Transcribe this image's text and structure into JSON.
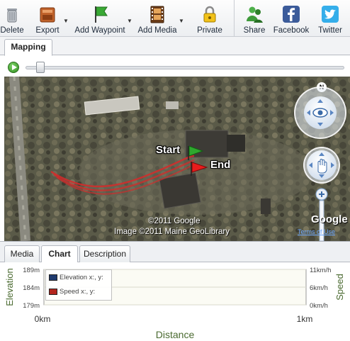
{
  "toolbar": {
    "buttons": [
      {
        "label": "Delete",
        "icon": "trash-icon"
      },
      {
        "label": "Export",
        "icon": "export-icon"
      },
      {
        "label": "Add Waypoint",
        "icon": "flag-icon"
      },
      {
        "label": "Add Media",
        "icon": "film-icon"
      },
      {
        "label": "Private",
        "icon": "lock-icon"
      },
      {
        "label": "Share",
        "icon": "people-icon"
      },
      {
        "label": "Facebook",
        "icon": "facebook-icon"
      },
      {
        "label": "Twitter",
        "icon": "twitter-icon"
      }
    ]
  },
  "top_tab": {
    "label": "Mapping"
  },
  "playback": {
    "position": 0.03
  },
  "map": {
    "start_label": "Start",
    "end_label": "End",
    "compass": "N",
    "credit_line1": "©2011 Google",
    "credit_line2": "Image ©2011 Maine GeoLibrary",
    "google_logo": "Google",
    "terms": "Terms of Use",
    "colors": {
      "track": "#d62a2a",
      "start_flag": "#2ea82e",
      "end_flag": "#e81c1c"
    }
  },
  "bottom_tabs": [
    {
      "label": "Media",
      "active": false
    },
    {
      "label": "Chart",
      "active": true
    },
    {
      "label": "Description",
      "active": false
    }
  ],
  "legend": {
    "elevation": "Elevation x:, y:",
    "speed": "Speed x:, y:",
    "colors": {
      "elevation": "#1f3a6e",
      "speed": "#b3261e"
    }
  },
  "chart_data": {
    "type": "line",
    "xlabel": "Distance",
    "ylabel_left": "Elevation",
    "ylabel_right": "Speed",
    "x_ticks": [
      "0km",
      "1km"
    ],
    "y_left_ticks": [
      "189m",
      "184m",
      "179m"
    ],
    "y_right_ticks": [
      "11km/h",
      "6km/h",
      "0km/h"
    ],
    "ylim_left": [
      179,
      189
    ],
    "ylim_right": [
      0,
      11
    ],
    "series": [
      {
        "name": "Elevation",
        "x": [],
        "y": []
      },
      {
        "name": "Speed",
        "x": [],
        "y": []
      }
    ],
    "grid": true
  }
}
